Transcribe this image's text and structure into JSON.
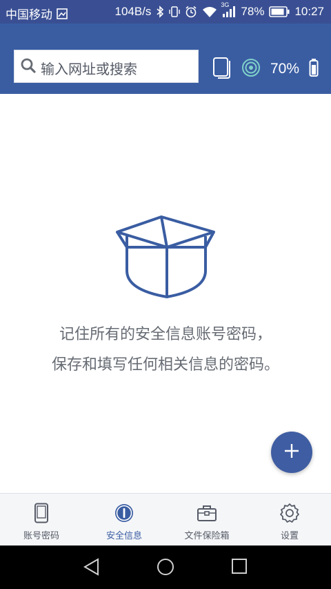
{
  "status_bar": {
    "carrier": "中国移动",
    "speed": "104B/s",
    "network": "3G",
    "battery": "78%",
    "time": "10:27"
  },
  "header": {
    "search_placeholder": "输入网址或搜索",
    "battery_percent": "70%"
  },
  "empty_state": {
    "line1": "记住所有的安全信息账号密码，",
    "line2": "保存和填写任何相关信息的密码。"
  },
  "tabs": [
    {
      "label": "账号密码",
      "icon": "phone-icon",
      "active": false
    },
    {
      "label": "安全信息",
      "icon": "info-icon",
      "active": true
    },
    {
      "label": "文件保险箱",
      "icon": "briefcase-icon",
      "active": false
    },
    {
      "label": "设置",
      "icon": "gear-icon",
      "active": false
    }
  ],
  "colors": {
    "primary": "#3a5da2",
    "status_bar": "#3a4f93",
    "text_gray": "#666b73"
  }
}
